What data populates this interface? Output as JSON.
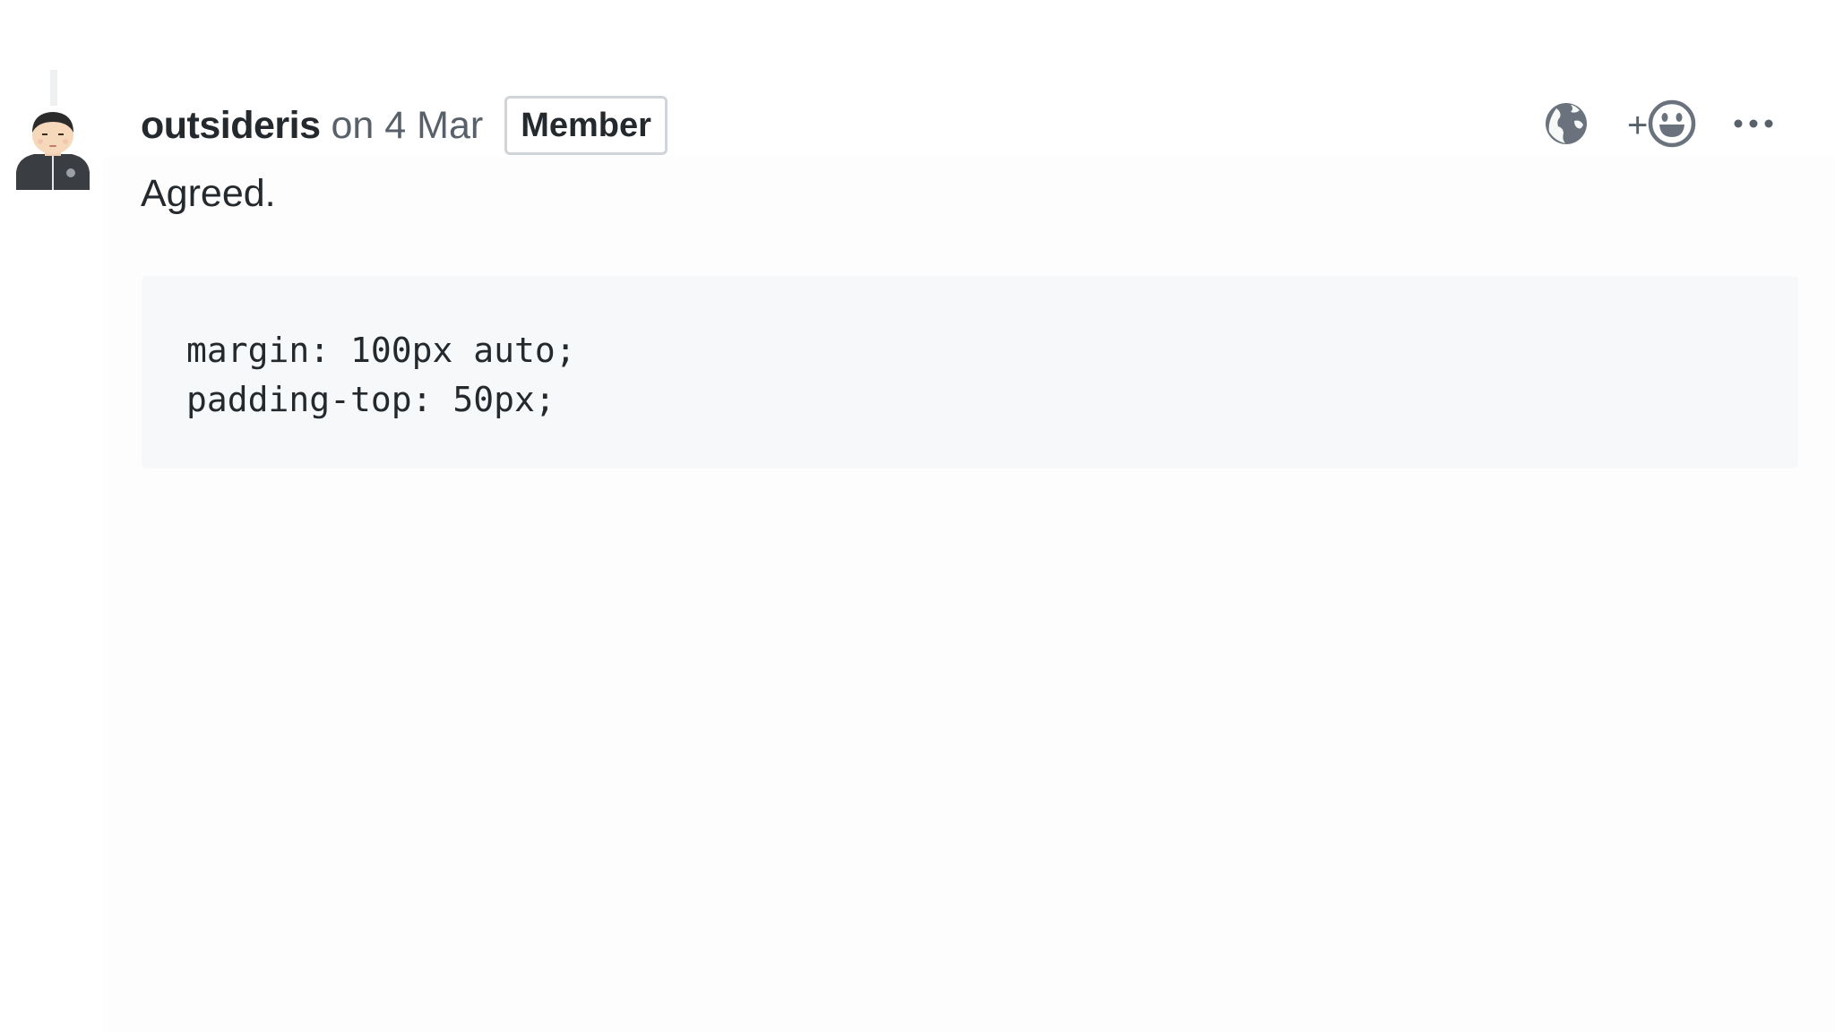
{
  "comment": {
    "author": "outsideris",
    "meta": "on 4 Mar",
    "badge": "Member",
    "body": "Agreed.",
    "code_lines": [
      "margin: 100px auto;",
      "padding-top: 50px;"
    ]
  },
  "actions": {
    "plus": "+",
    "icons": [
      "globe-icon",
      "smiley-icon",
      "ellipsis-icon"
    ]
  },
  "colors": {
    "text": "#24292e",
    "muted": "#586069",
    "icon": "#6a737d",
    "code_bg": "#f6f8fa",
    "badge_border": "#d1d5da"
  }
}
